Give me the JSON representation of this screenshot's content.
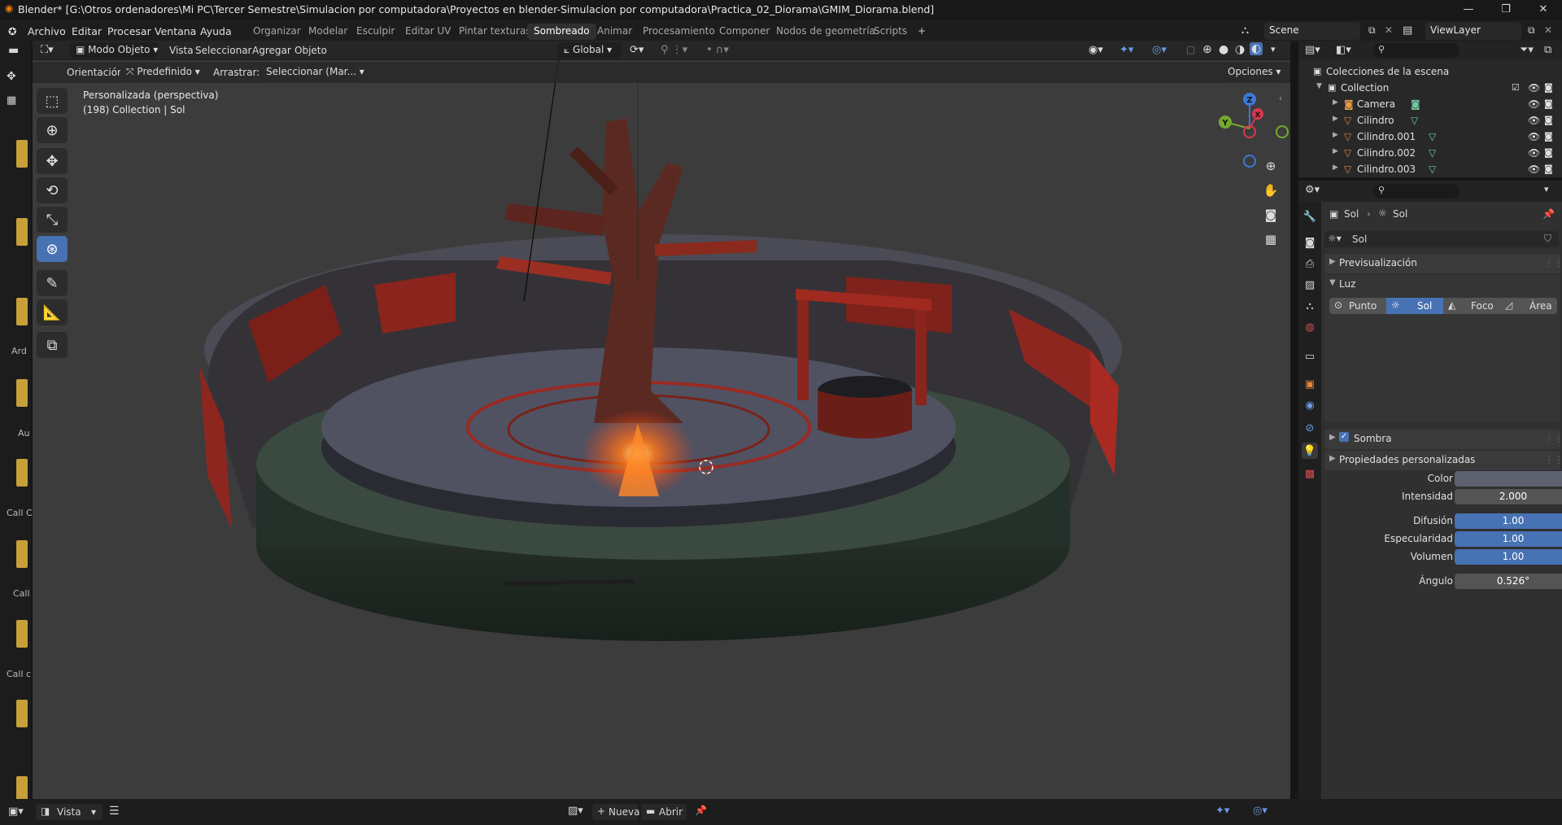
{
  "titlebar": {
    "title": "Blender* [G:\\Otros ordenadores\\Mi PC\\Tercer Semestre\\Simulacion por computadora\\Proyectos en blender-Simulacion por computadora\\Practica_02_Diorama\\GMIM_Diorama.blend]",
    "minimize": "—",
    "maximize": "❐",
    "close": "✕"
  },
  "menubar": {
    "menus": [
      "Archivo",
      "Editar",
      "Procesar",
      "Ventana",
      "Ayuda"
    ],
    "workspaces": [
      "Organizar",
      "Modelar",
      "Esculpir",
      "Editar UV",
      "Pintar texturas",
      "Sombreado",
      "Animar",
      "Procesamiento",
      "Componer",
      "Nodos de geometría",
      "Scripts"
    ],
    "active_workspace": "Sombreado",
    "add_tab": "+",
    "scene": "Scene",
    "view_layer": "ViewLayer"
  },
  "viewport_header": {
    "mode": "Modo Objeto",
    "menus": [
      "Vista",
      "Seleccionar",
      "Agregar",
      "Objeto"
    ],
    "transform_orientation": "Global",
    "orientation_label": "Orientación:",
    "orientation_value": "Predefinido",
    "drag_label": "Arrastrar:",
    "drag_value": "Seleccionar (Mar...",
    "options": "Opciones"
  },
  "viewport": {
    "view_name": "Personalizada (perspectiva)",
    "context": "(198) Collection | Sol",
    "gizmo_axes": [
      "Z",
      "Y",
      "X"
    ]
  },
  "left_strip": {
    "labels": [
      "Ard",
      "Au",
      "Call C",
      "Call",
      "Call c"
    ]
  },
  "outliner": {
    "root": "Colecciones de la escena",
    "collection": "Collection",
    "items": [
      {
        "name": "Camera",
        "icon": "camera-icon"
      },
      {
        "name": "Cilindro",
        "icon": "mesh-icon"
      },
      {
        "name": "Cilindro.001",
        "icon": "mesh-icon"
      },
      {
        "name": "Cilindro.002",
        "icon": "mesh-icon"
      },
      {
        "name": "Cilindro.003",
        "icon": "mesh-icon"
      }
    ]
  },
  "properties": {
    "breadcrumb_object": "Sol",
    "breadcrumb_data": "Sol",
    "datablock_name": "Sol",
    "panels": {
      "preview": "Previsualización",
      "light": "Luz",
      "shadow": "Sombra",
      "custom": "Propiedades personalizadas"
    },
    "light_types": [
      "Punto",
      "Sol",
      "Foco",
      "Área"
    ],
    "active_light_type": "Sol",
    "fields": {
      "color_label": "Color",
      "intensity_label": "Intensidad",
      "intensity_value": "2.000",
      "diffuse_label": "Difusión",
      "diffuse_value": "1.00",
      "specular_label": "Especularidad",
      "specular_value": "1.00",
      "volume_label": "Volumen",
      "volume_value": "1.00",
      "angle_label": "Ángulo",
      "angle_value": "0.526°"
    },
    "shadow_enabled": true
  },
  "bottombar": {
    "view_label": "Vista",
    "new_label": "Nueva",
    "open_label": "Abrir"
  },
  "colors": {
    "accent": "#4772b3",
    "viewport_bg": "#3c3c3c",
    "fire": "#ff6a1a",
    "red_wall": "#a82a22"
  }
}
